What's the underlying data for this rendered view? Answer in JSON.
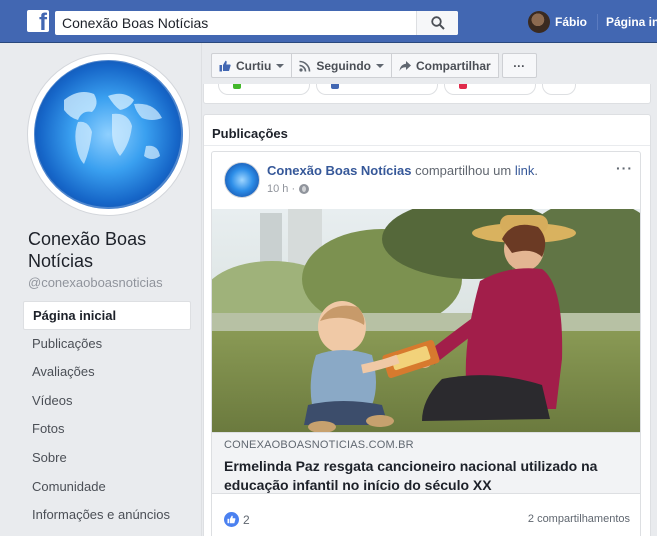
{
  "topbar": {
    "logo": "f",
    "search_value": "Conexão Boas Notícias",
    "user_name": "Fábio",
    "home_link": "Página inicial"
  },
  "page": {
    "name": "Conexão Boas Notícias",
    "handle": "@conexaoboasnoticias"
  },
  "nav": {
    "items": [
      {
        "label": "Página inicial"
      },
      {
        "label": "Publicações"
      },
      {
        "label": "Avaliações"
      },
      {
        "label": "Vídeos"
      },
      {
        "label": "Fotos"
      },
      {
        "label": "Sobre"
      },
      {
        "label": "Comunidade"
      },
      {
        "label": "Informações e anúncios"
      }
    ]
  },
  "actions": {
    "like": "Curtiu",
    "follow": "Seguindo",
    "share": "Compartilhar",
    "more": "···"
  },
  "publications": {
    "title": "Publicações",
    "post": {
      "author": "Conexão Boas Notícias",
      "shared_text": "compartilhou um",
      "link_word": "link",
      "time": "10 h ·",
      "link_domain": "CONEXAOBOASNOTICIAS.COM.BR",
      "link_title": "Ermelinda Paz resgata cancioneiro nacional utilizado na educação infantil no início do século XX",
      "like_count": "2",
      "shares": "2 compartilhamentos",
      "dots": "···"
    }
  },
  "colors": {
    "brand_blue": "#4267b2",
    "link_blue": "#365899",
    "background": "#e9ebee"
  },
  "icons": [
    "search-icon",
    "thumbs-up-icon",
    "rss-icon",
    "share-arrow-icon",
    "globe-icon",
    "like-icon"
  ]
}
